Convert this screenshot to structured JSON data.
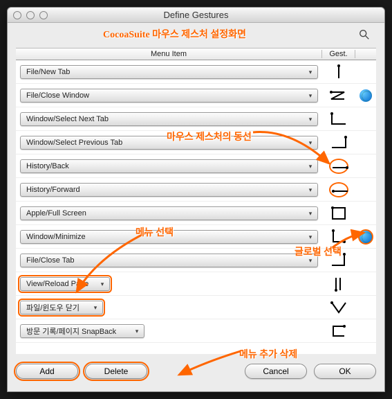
{
  "window": {
    "title": "Define Gestures"
  },
  "annotations": {
    "main_title": "CocoaSuite 마우스 제스처 설정화면",
    "gesture_line": "마우스 제스처의 동선",
    "menu_select": "메뉴 선택",
    "global_select": "글로벌 선택",
    "add_delete": "메뉴 추가 삭제"
  },
  "headers": {
    "menu": "Menu Item",
    "gest": "Gest."
  },
  "rows": [
    {
      "label": "File/New Tab",
      "gesture": "down",
      "globe": false
    },
    {
      "label": "File/Close Window",
      "gesture": "zigzag",
      "globe": true
    },
    {
      "label": "Window/Select Next Tab",
      "gesture": "corner-ur",
      "globe": false
    },
    {
      "label": "Window/Select Previous Tab",
      "gesture": "corner-ul",
      "globe": false
    },
    {
      "label": "History/Back",
      "gesture": "left",
      "globe": false
    },
    {
      "label": "History/Forward",
      "gesture": "right",
      "globe": false
    },
    {
      "label": "Apple/Full Screen",
      "gesture": "box",
      "globe": false
    },
    {
      "label": "Window/Minimize",
      "gesture": "down-right-dot",
      "globe": true
    },
    {
      "label": "File/Close Tab",
      "gesture": "down-left",
      "globe": false
    },
    {
      "label": "View/Reload Page",
      "gesture": "up-down",
      "globe": false
    },
    {
      "label": "파일/윈도우 닫기",
      "gesture": "v-shape",
      "globe": false
    },
    {
      "label": "방문 기록/페이지 SnapBack",
      "gesture": "square-open",
      "globe": false
    }
  ],
  "buttons": {
    "add": "Add",
    "delete": "Delete",
    "cancel": "Cancel",
    "ok": "OK"
  }
}
